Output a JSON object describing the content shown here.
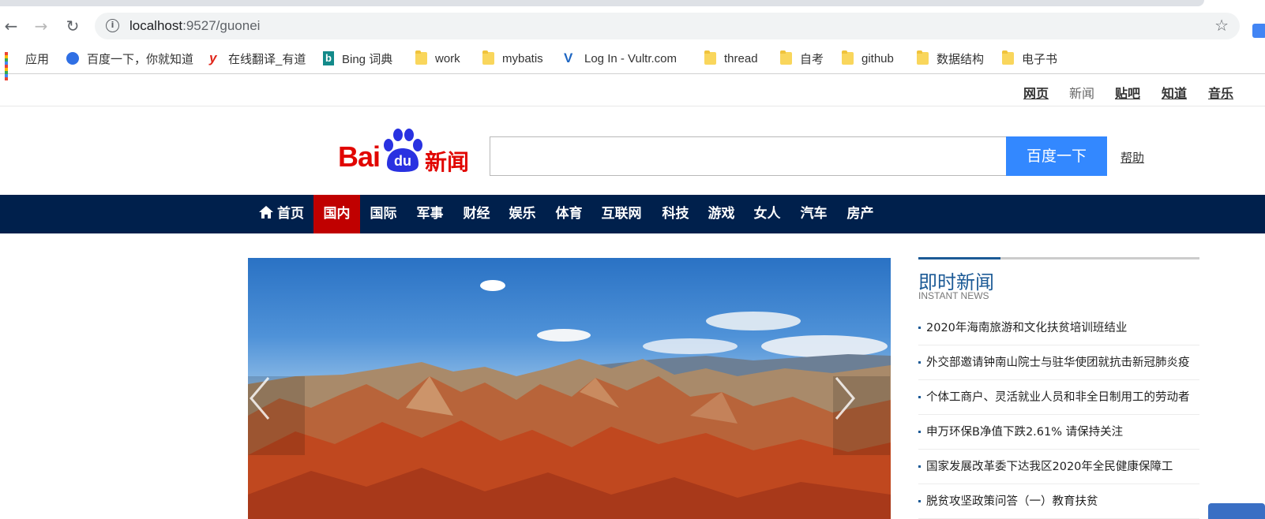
{
  "browser": {
    "url_host": "localhost",
    "url_path": ":9527/guonei",
    "bookmarks": [
      {
        "label": "应用",
        "icon": "apps-grid-icon"
      },
      {
        "label": "百度一下，你就知道",
        "icon": "baidu-paw-icon"
      },
      {
        "label": "在线翻译_有道",
        "icon": "youdao-icon"
      },
      {
        "label": "Bing 词典",
        "icon": "bing-icon"
      },
      {
        "label": "work",
        "icon": "folder-icon"
      },
      {
        "label": "mybatis",
        "icon": "folder-icon"
      },
      {
        "label": "Log In - Vultr.com",
        "icon": "vultr-icon"
      },
      {
        "label": "thread",
        "icon": "folder-icon"
      },
      {
        "label": "自考",
        "icon": "folder-icon"
      },
      {
        "label": "github",
        "icon": "folder-icon"
      },
      {
        "label": "数据结构",
        "icon": "folder-icon"
      },
      {
        "label": "电子书",
        "icon": "folder-icon"
      }
    ]
  },
  "topnav": [
    "网页",
    "新闻",
    "贴吧",
    "知道",
    "音乐"
  ],
  "logo": {
    "bai": "Bai",
    "du": "du",
    "xinwen": "新闻"
  },
  "search": {
    "value": "",
    "button": "百度一下",
    "help": "帮助"
  },
  "channels": [
    "首页",
    "国内",
    "国际",
    "军事",
    "财经",
    "娱乐",
    "体育",
    "互联网",
    "科技",
    "游戏",
    "女人",
    "汽车",
    "房产"
  ],
  "active_channel": "国内",
  "colors": {
    "channel_bar": "#00204c",
    "active_channel": "#c00000",
    "accent_blue": "#1c5a96",
    "search_button": "#3388ff",
    "logo_red": "#e10601"
  },
  "instant_news": {
    "title": "即时新闻",
    "subtitle": "INSTANT NEWS",
    "items": [
      "2020年海南旅游和文化扶贫培训班结业",
      "外交部邀请钟南山院士与驻华使团就抗击新冠肺炎疫",
      "个体工商户、灵活就业人员和非全日制用工的劳动者",
      "申万环保B净值下跌2.61% 请保持关注",
      "国家发展改革委下达我区2020年全民健康保障工",
      "脱贫攻坚政策问答（一）教育扶贫"
    ]
  }
}
